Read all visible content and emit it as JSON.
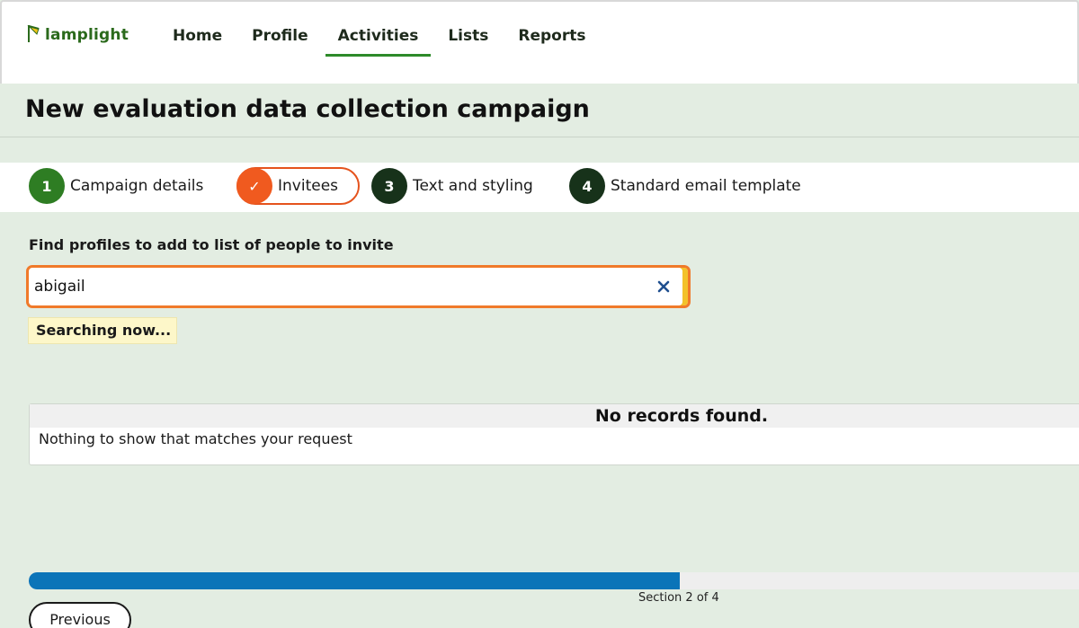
{
  "brand": {
    "logo_text": "lamplight",
    "color": "#2b6a1c"
  },
  "nav": {
    "items": [
      {
        "label": "Home"
      },
      {
        "label": "Profile"
      },
      {
        "label": "Activities",
        "active": true
      },
      {
        "label": "Lists"
      },
      {
        "label": "Reports"
      }
    ]
  },
  "page": {
    "title": "New evaluation data collection campaign"
  },
  "steps": [
    {
      "number": "1",
      "label": "Campaign details",
      "state": "complete"
    },
    {
      "number": "✓",
      "label": "Invitees",
      "state": "current"
    },
    {
      "number": "3",
      "label": "Text and styling",
      "state": "pending"
    },
    {
      "number": "4",
      "label": "Standard email template",
      "state": "pending"
    }
  ],
  "search": {
    "label": "Find profiles to add to list of people to invite",
    "value": "abigail",
    "clear_icon": "close-icon",
    "status": "Searching now..."
  },
  "results": {
    "heading": "No records found.",
    "message": "Nothing to show that matches your request"
  },
  "progress": {
    "fraction": 0.62,
    "text": "Section 2 of 4"
  },
  "footer": {
    "previous_label": "Previous"
  },
  "colors": {
    "background": "#e3ede2",
    "accent_orange": "#f05a1f",
    "step_complete": "#2e7d23",
    "step_pending": "#17321a",
    "progress": "#0b74b8"
  }
}
